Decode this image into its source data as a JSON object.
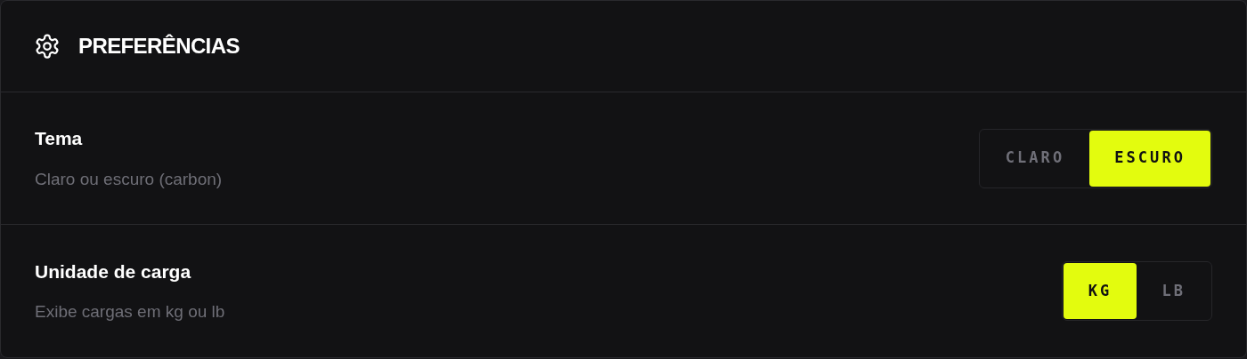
{
  "panel": {
    "title": "PREFERÊNCIAS"
  },
  "settings": [
    {
      "label": "Tema",
      "description": "Claro ou escuro (carbon)",
      "options": [
        {
          "label": "CLARO",
          "selected": false
        },
        {
          "label": "ESCURO",
          "selected": true
        }
      ]
    },
    {
      "label": "Unidade de carga",
      "description": "Exibe cargas em kg ou lb",
      "options": [
        {
          "label": "KG",
          "selected": true
        },
        {
          "label": "LB",
          "selected": false
        }
      ]
    }
  ]
}
